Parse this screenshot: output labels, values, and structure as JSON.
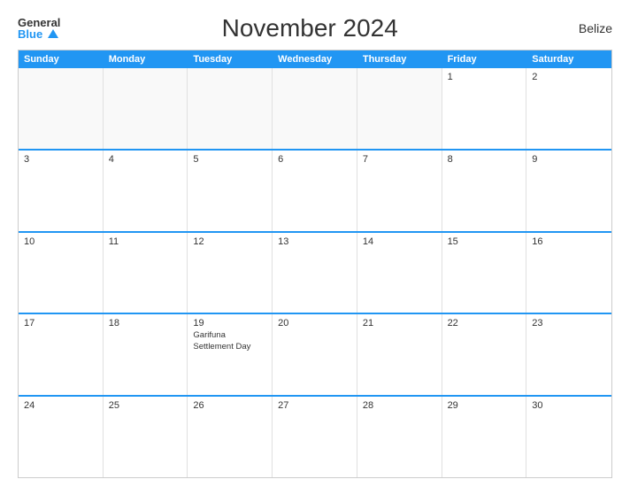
{
  "header": {
    "title": "November 2024",
    "country": "Belize",
    "logo_general": "General",
    "logo_blue": "Blue"
  },
  "days_of_week": [
    "Sunday",
    "Monday",
    "Tuesday",
    "Wednesday",
    "Thursday",
    "Friday",
    "Saturday"
  ],
  "weeks": [
    [
      {
        "day": "",
        "empty": true
      },
      {
        "day": "",
        "empty": true
      },
      {
        "day": "",
        "empty": true
      },
      {
        "day": "",
        "empty": true
      },
      {
        "day": "",
        "empty": true
      },
      {
        "day": "1",
        "empty": false
      },
      {
        "day": "2",
        "empty": false
      }
    ],
    [
      {
        "day": "3",
        "empty": false
      },
      {
        "day": "4",
        "empty": false
      },
      {
        "day": "5",
        "empty": false
      },
      {
        "day": "6",
        "empty": false
      },
      {
        "day": "7",
        "empty": false
      },
      {
        "day": "8",
        "empty": false
      },
      {
        "day": "9",
        "empty": false
      }
    ],
    [
      {
        "day": "10",
        "empty": false
      },
      {
        "day": "11",
        "empty": false
      },
      {
        "day": "12",
        "empty": false
      },
      {
        "day": "13",
        "empty": false
      },
      {
        "day": "14",
        "empty": false
      },
      {
        "day": "15",
        "empty": false
      },
      {
        "day": "16",
        "empty": false
      }
    ],
    [
      {
        "day": "17",
        "empty": false
      },
      {
        "day": "18",
        "empty": false
      },
      {
        "day": "19",
        "empty": false,
        "event": "Garifuna Settlement Day"
      },
      {
        "day": "20",
        "empty": false
      },
      {
        "day": "21",
        "empty": false
      },
      {
        "day": "22",
        "empty": false
      },
      {
        "day": "23",
        "empty": false
      }
    ],
    [
      {
        "day": "24",
        "empty": false
      },
      {
        "day": "25",
        "empty": false
      },
      {
        "day": "26",
        "empty": false
      },
      {
        "day": "27",
        "empty": false
      },
      {
        "day": "28",
        "empty": false
      },
      {
        "day": "29",
        "empty": false
      },
      {
        "day": "30",
        "empty": false
      }
    ]
  ],
  "accent_color": "#2196F3"
}
